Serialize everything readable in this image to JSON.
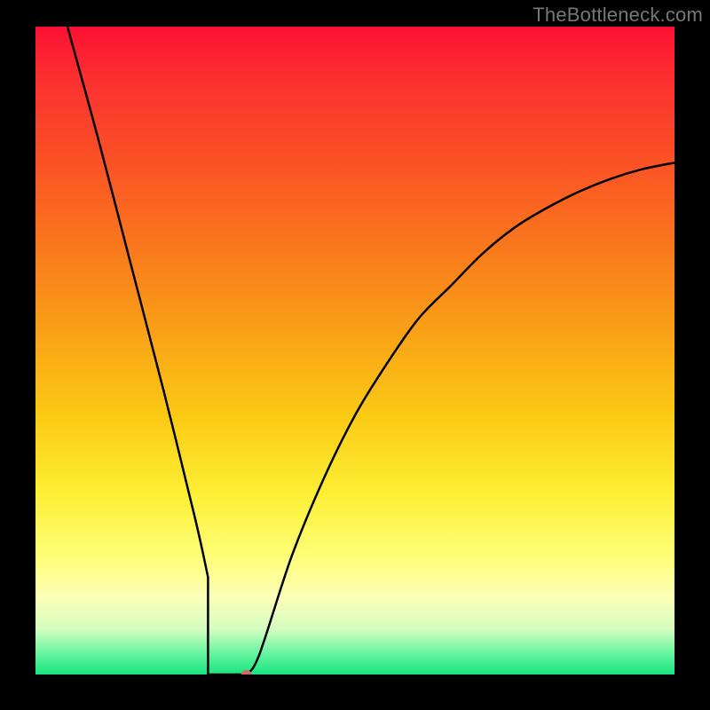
{
  "watermark": "TheBottleneck.com",
  "chart_data": {
    "type": "line",
    "title": "",
    "xlabel": "",
    "ylabel": "",
    "xlim": [
      0,
      100
    ],
    "ylim": [
      0,
      100
    ],
    "grid": false,
    "background_gradient": {
      "orientation": "vertical",
      "stops": [
        {
          "pos": 0,
          "color": "#fb1034"
        },
        {
          "pos": 22,
          "color": "#fa5524"
        },
        {
          "pos": 48,
          "color": "#f9a417"
        },
        {
          "pos": 72,
          "color": "#fdef34"
        },
        {
          "pos": 88,
          "color": "#fcffb8"
        },
        {
          "pos": 100,
          "color": "#17e47f"
        }
      ]
    },
    "series": [
      {
        "name": "bottleneck-curve",
        "color": "#000000",
        "x": [
          5,
          10,
          15,
          20,
          25,
          27,
          30,
          33,
          35,
          40,
          45,
          50,
          55,
          60,
          65,
          70,
          75,
          80,
          85,
          90,
          95,
          100
        ],
        "y": [
          100,
          82,
          63,
          44,
          24,
          15,
          3,
          0,
          3,
          18,
          30,
          40,
          48,
          55,
          60,
          65,
          69,
          72,
          74.5,
          76.5,
          78,
          79
        ]
      }
    ],
    "markers": [
      {
        "name": "minimum-dot",
        "x": 33,
        "y": 0,
        "color": "#d46a5f",
        "rx": 6,
        "ry": 5
      }
    ],
    "flat_segment": {
      "x_from": 27,
      "x_to": 33,
      "y": 0
    }
  }
}
